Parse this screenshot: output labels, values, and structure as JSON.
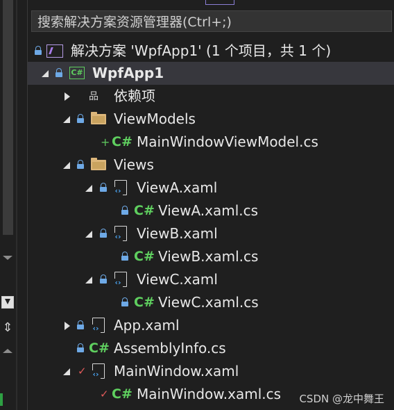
{
  "search": {
    "placeholder": "搜索解决方案资源管理器(Ctrl+;)"
  },
  "tree": {
    "solution": "解决方案 'WpfApp1' (1 个项目，共 1 个)",
    "project": "WpfApp1",
    "dependencies": "依赖项",
    "folder_viewmodels": "ViewModels",
    "file_mainwindowviewmodel": "MainWindowViewModel.cs",
    "folder_views": "Views",
    "file_viewa": "ViewA.xaml",
    "file_viewa_cs": "ViewA.xaml.cs",
    "file_viewb": "ViewB.xaml",
    "file_viewb_cs": "ViewB.xaml.cs",
    "file_viewc": "ViewC.xaml",
    "file_viewc_cs": "ViewC.xaml.cs",
    "file_app": "App.xaml",
    "file_assemblyinfo": "AssemblyInfo.cs",
    "file_mainwindow": "MainWindow.xaml",
    "file_mainwindow_cs": "MainWindow.xaml.cs"
  },
  "icons": {
    "csharp": "C#",
    "cs_project": "C#",
    "dependencies": "品"
  },
  "watermark": "CSDN @龙中舞王",
  "colors": {
    "background": "#1f1f1f",
    "selected_row": "#37373d",
    "lock": "#6ea9e6",
    "csharp": "#5fcf5f",
    "folder": "#dcb67a",
    "added": "#5cc35c",
    "modified": "#e05a5a"
  }
}
